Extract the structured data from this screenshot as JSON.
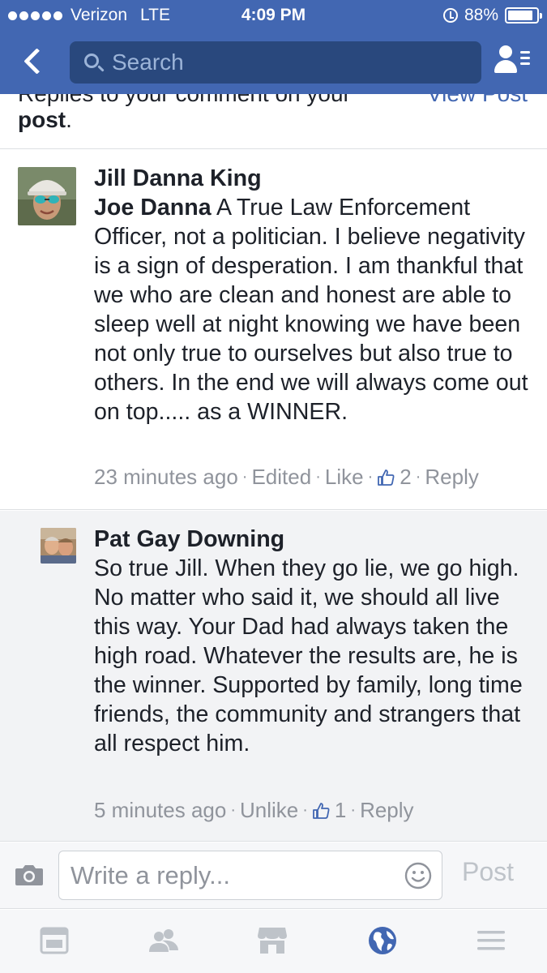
{
  "status_bar": {
    "carrier": "Verizon",
    "network": "LTE",
    "time": "4:09 PM",
    "battery": "88%",
    "battery_level": 0.88
  },
  "nav": {
    "back_icon": "chevron-left-icon",
    "search_placeholder": "Search",
    "friends_icon": "friends-list-icon"
  },
  "notification": {
    "cut_text": "Replies to your comment on your",
    "post_word": "post",
    "period": ".",
    "view_post": "View Post"
  },
  "comments": [
    {
      "author": "Jill Danna King",
      "tagged": "Joe Danna",
      "text": " A True Law Enforcement Officer, not a politician. I believe negativity is a sign of desperation. I am thankful that we who are clean and honest are able to sleep well at night knowing we have been not only true to ourselves but also true to others. In the end we will always come out on top..... as a WINNER.",
      "time": "23 minutes ago",
      "edited": "Edited",
      "like": "Like",
      "like_count": "2",
      "reply": "Reply"
    },
    {
      "author": "Pat Gay Downing",
      "text": "So true Jill.   When they go lie, we go high. No matter who said it, we should all live this way. Your Dad had always taken the high road.  Whatever the results are, he is the winner. Supported by family, long time friends, the community and strangers that all respect him.",
      "time": "5 minutes ago",
      "like": "Unlike",
      "like_count": "1",
      "reply": "Reply"
    }
  ],
  "composer": {
    "camera_icon": "camera-icon",
    "placeholder": "Write a reply...",
    "emoji_icon": "smiley-icon",
    "post_label": "Post"
  },
  "tabbar": {
    "items": [
      "news-feed-icon",
      "friend-requests-icon",
      "marketplace-icon",
      "notifications-globe-icon",
      "menu-icon"
    ],
    "active": "notifications-globe-icon"
  },
  "colors": {
    "brand": "#4267b2",
    "search_bg": "#29487d",
    "meta_gray": "#90949c",
    "link_blue": "#4267b2",
    "reply_bg": "#f2f3f5"
  }
}
